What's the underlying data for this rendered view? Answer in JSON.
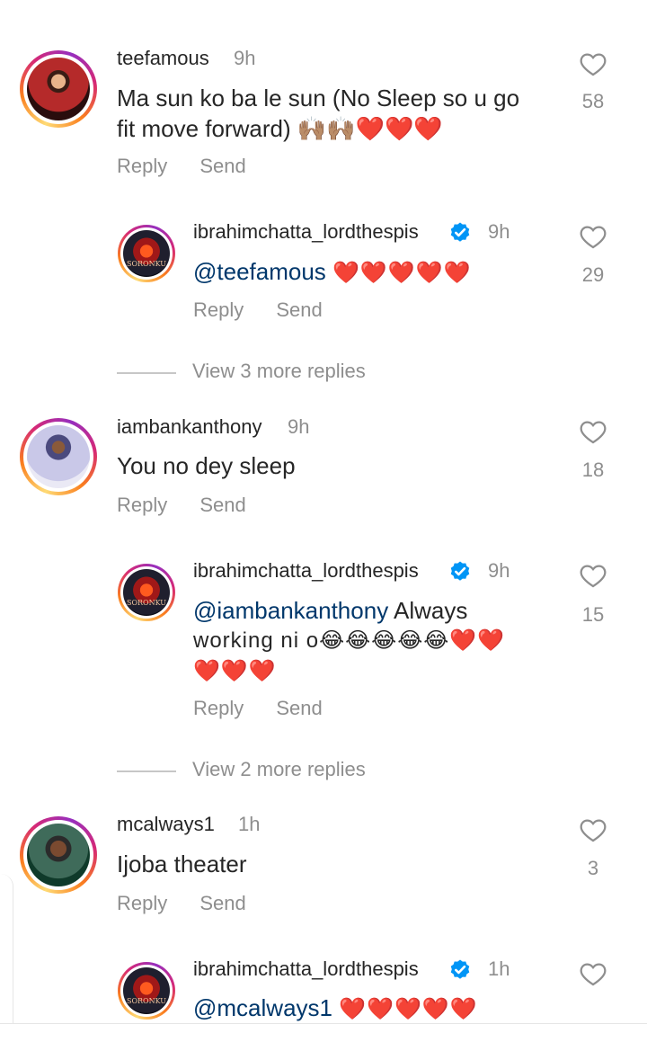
{
  "comments": [
    {
      "username": "teefamous",
      "time": "9h",
      "text": "Ma sun ko ba le sun (No Sleep so u go fit move forward) 🙌🏽🙌🏽❤️❤️❤️",
      "text_line1": "Ma sun ko ba le sun (No Sleep so u go",
      "text_line2": "fit move forward) 🙌🏽🙌🏽❤️❤️❤️",
      "likes": "58",
      "reply_label": "Reply",
      "send_label": "Send"
    },
    {
      "username": "iambankanthony",
      "time": "9h",
      "text": "You no dey sleep",
      "likes": "18",
      "reply_label": "Reply",
      "send_label": "Send"
    },
    {
      "username": "mcalways1",
      "time": "1h",
      "text": "Ijoba theater",
      "likes": "3",
      "reply_label": "Reply",
      "send_label": "Send"
    }
  ],
  "replies": [
    {
      "username": "ibrahimchatta_lordthespis",
      "time": "9h",
      "mention": "@teefamous",
      "emojis": "❤️❤️❤️❤️❤️",
      "likes": "29",
      "reply_label": "Reply",
      "send_label": "Send"
    },
    {
      "username": "ibrahimchatta_lordthespis",
      "time": "9h",
      "mention": "@iambankanthony",
      "text_after": " Always",
      "line2": "working ni o😂😂😂😂😂❤️❤️",
      "line3": "❤️❤️❤️",
      "likes": "15",
      "reply_label": "Reply",
      "send_label": "Send"
    },
    {
      "username": "ibrahimchatta_lordthespis",
      "time": "1h",
      "mention": "@mcalways1",
      "emojis": "❤️❤️❤️❤️❤️"
    }
  ],
  "view_more": [
    "View 3 more replies",
    "View 2 more replies"
  ],
  "avatar_text": "SORONKU",
  "icons": {
    "heart": "heart-outline-icon",
    "verified": "verified-badge-icon"
  },
  "colors": {
    "text": "#262626",
    "secondary": "#8e8e8e",
    "mention": "#00376b",
    "verified": "#0095f6"
  }
}
